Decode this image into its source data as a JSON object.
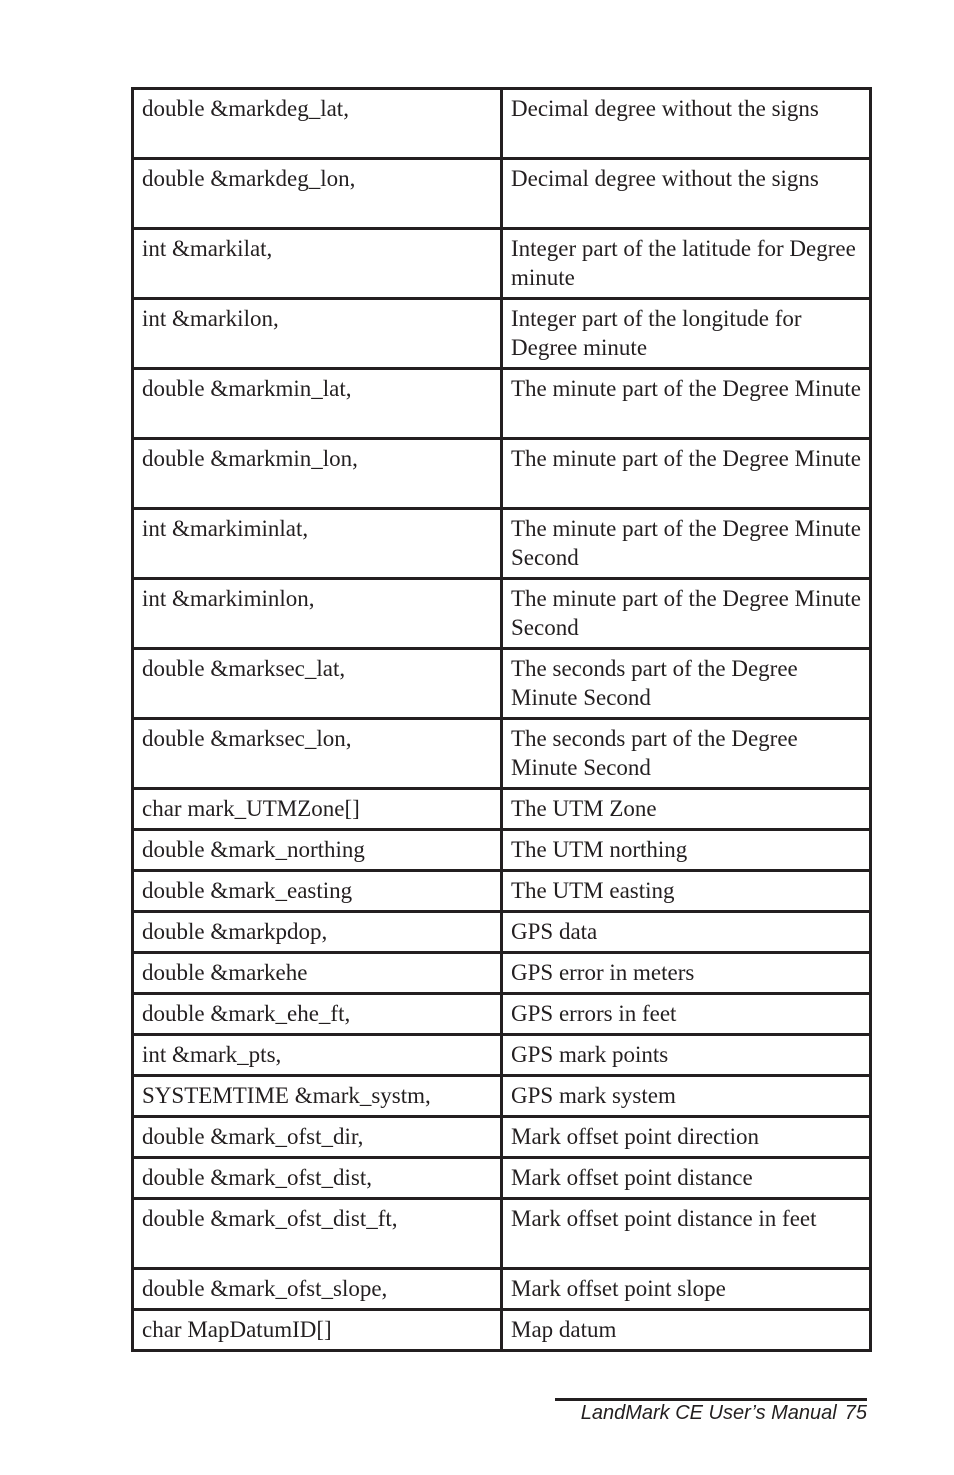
{
  "table": {
    "rows": [
      {
        "param": "double &markdeg_lat,",
        "desc": "Decimal degree without the signs",
        "lines": 2
      },
      {
        "param": "double &markdeg_lon,",
        "desc": "Decimal degree without the signs",
        "lines": 2
      },
      {
        "param": "int &markilat,",
        "desc": "Integer part of the latitude for Degree minute",
        "lines": 2
      },
      {
        "param": "int &markilon,",
        "desc": "Integer part of the longitude for Degree minute",
        "lines": 2
      },
      {
        "param": "double &markmin_lat,",
        "desc": "The minute part of the Degree Minute",
        "lines": 2
      },
      {
        "param": "double &markmin_lon,",
        "desc": "The minute part of the Degree Minute",
        "lines": 2
      },
      {
        "param": "int &markiminlat,",
        "desc": "The minute part of the Degree Minute Second",
        "lines": 2
      },
      {
        "param": "int &markiminlon,",
        "desc": "The minute part of the Degree Minute Second",
        "lines": 2
      },
      {
        "param": "double &marksec_lat,",
        "desc": "The seconds part of the Degree Minute Second",
        "lines": 2
      },
      {
        "param": "double &marksec_lon,",
        "desc": "The seconds part of the Degree Minute Second",
        "lines": 2
      },
      {
        "param": "char mark_UTMZone[]",
        "desc": "The UTM Zone",
        "lines": 1
      },
      {
        "param": "double &mark_northing",
        "desc": "The UTM northing",
        "lines": 1
      },
      {
        "param": "double &mark_easting",
        "desc": "The UTM easting",
        "lines": 1
      },
      {
        "param": "double &markpdop,",
        "desc": "GPS data",
        "lines": 1
      },
      {
        "param": "double &markehe",
        "desc": "GPS error in meters",
        "lines": 1
      },
      {
        "param": "double &mark_ehe_ft,",
        "desc": "GPS errors in feet",
        "lines": 1
      },
      {
        "param": "int &mark_pts,",
        "desc": "GPS mark points",
        "lines": 1
      },
      {
        "param": "SYSTEMTIME &mark_systm,",
        "desc": "GPS mark system",
        "lines": 1
      },
      {
        "param": "double &mark_ofst_dir,",
        "desc": "Mark offset point direction",
        "lines": 1
      },
      {
        "param": "double &mark_ofst_dist,",
        "desc": "Mark offset point distance",
        "lines": 1
      },
      {
        "param": "double &mark_ofst_dist_ft,",
        "desc": "Mark offset point distance in feet",
        "lines": 2
      },
      {
        "param": "double &mark_ofst_slope,",
        "desc": "Mark offset point slope",
        "lines": 1
      },
      {
        "param": "char MapDatumID[]",
        "desc": "Map datum",
        "lines": 1
      }
    ]
  },
  "footer": {
    "title": "LandMark CE User’s Manual",
    "page_number": "75"
  }
}
